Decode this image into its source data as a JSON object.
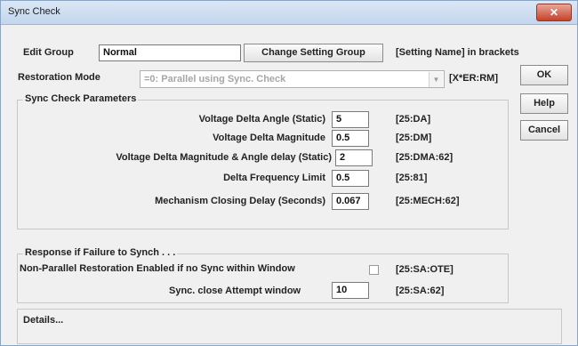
{
  "window": {
    "title": "Sync Check",
    "close_label": "✕"
  },
  "edit_group": {
    "label": "Edit Group",
    "value": "Normal",
    "change_button": "Change Setting Group",
    "note": "[Setting Name] in brackets"
  },
  "restoration": {
    "label": "Restoration Mode",
    "value": "=0: Parallel using Sync. Check",
    "tag": "[X*ER:RM]"
  },
  "buttons": {
    "ok": "OK",
    "help": "Help",
    "cancel": "Cancel"
  },
  "sync_params": {
    "title": "Sync Check Parameters",
    "rows": [
      {
        "label": "Voltage Delta Angle (Static)",
        "value": "5",
        "tag": "[25:DA]"
      },
      {
        "label": "Voltage Delta Magnitude",
        "value": "0.5",
        "tag": "[25:DM]"
      },
      {
        "label": "Voltage Delta Magnitude & Angle delay (Static)",
        "value": "2",
        "tag": "[25:DMA:62]"
      },
      {
        "label": "Delta Frequency Limit",
        "value": "0.5",
        "tag": "[25:81]"
      },
      {
        "label": "Mechanism Closing Delay (Seconds)",
        "value": "0.067",
        "tag": "[25:MECH:62]"
      }
    ]
  },
  "failure": {
    "title": "Response if Failure to Synch . . .",
    "non_parallel_label": "Non-Parallel Restoration Enabled if no Sync within Window",
    "non_parallel_checked": false,
    "non_parallel_tag": "[25:SA:OTE]",
    "window_label": "Sync. close Attempt window",
    "window_value": "10",
    "window_tag": "[25:SA:62]"
  },
  "details": {
    "title": "Details..."
  }
}
